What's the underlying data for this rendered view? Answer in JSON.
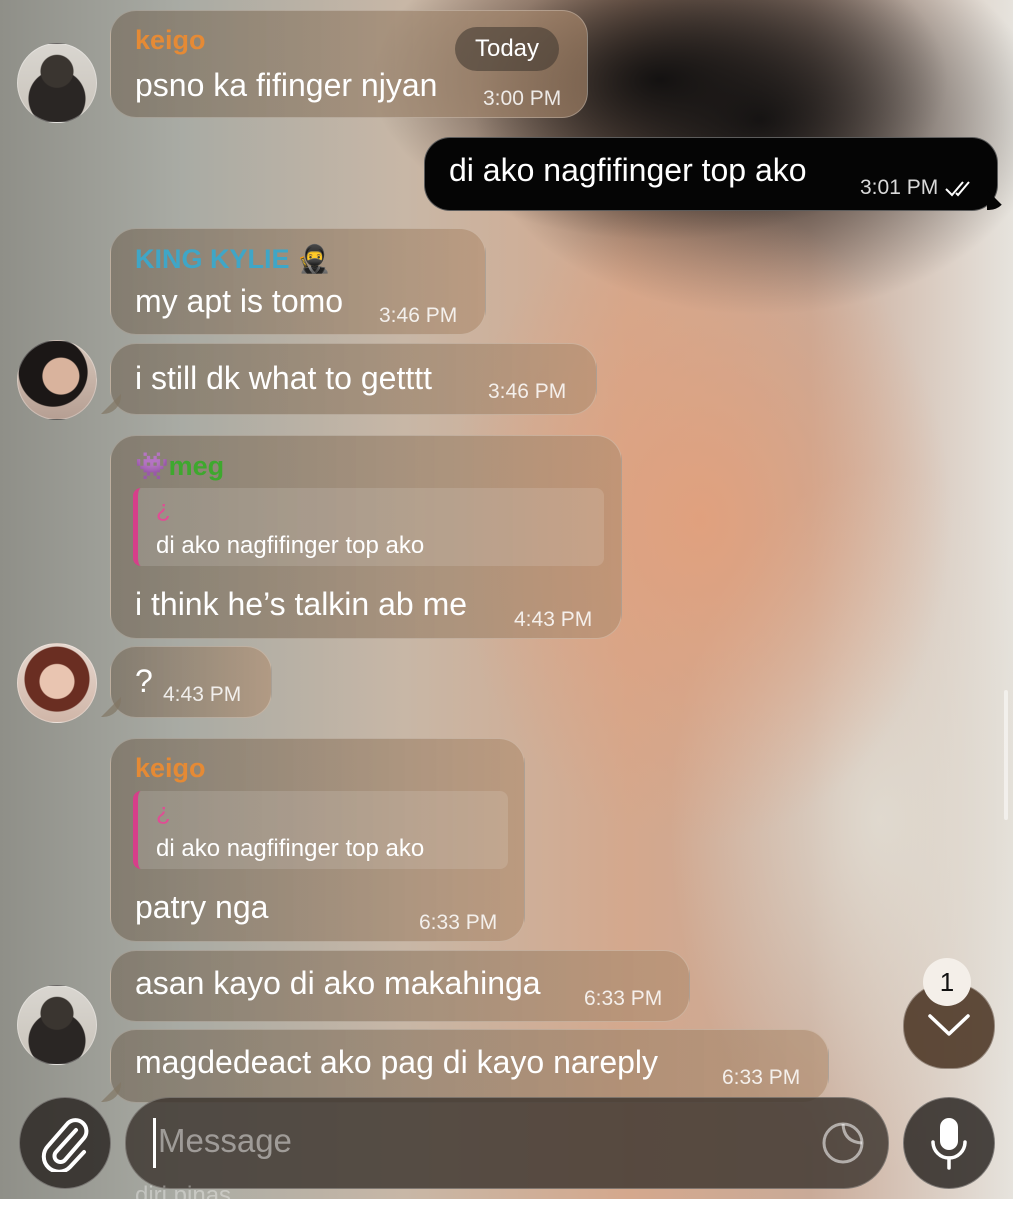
{
  "date_chip": "Today",
  "messages": [
    {
      "id": "m1",
      "sender": "keigo",
      "sender_color": "#e58a35",
      "text": "psno ka fifinger njyan",
      "time": "3:00 PM"
    },
    {
      "id": "m2",
      "outgoing": true,
      "text": "di ako nagfifinger top ako",
      "time": "3:01 PM",
      "status": "read"
    },
    {
      "id": "m3",
      "sender": "KING KYLIE 🥷",
      "sender_color": "#3fa6c7",
      "text": "my apt is tomo",
      "time": "3:46 PM"
    },
    {
      "id": "m4",
      "text": "i still dk what to getttt",
      "time": "3:46 PM"
    },
    {
      "id": "m5",
      "sender": "👾meg",
      "sender_color": "#3ea82e",
      "reply": {
        "author": "¿",
        "text": "di ako nagfifinger top ako"
      },
      "text": "i think he’s talkin ab me",
      "time": "4:43 PM"
    },
    {
      "id": "m6",
      "text": "?",
      "time": "4:43 PM"
    },
    {
      "id": "m7",
      "sender": "keigo",
      "sender_color": "#e58a35",
      "reply": {
        "author": "¿",
        "text": "di ako nagfifinger top ako"
      },
      "text": "patry nga",
      "time": "6:33 PM"
    },
    {
      "id": "m8",
      "text": "asan kayo di ako makahinga",
      "time": "6:33 PM"
    },
    {
      "id": "m9",
      "text": "magdedeact ako pag di kayo nareply",
      "time": "6:33 PM"
    }
  ],
  "unread_badge": "1",
  "composer": {
    "placeholder": "Message"
  },
  "ghost_text": "diri pinas",
  "icons": {
    "attach": "paperclip-icon",
    "sticker": "sticker-icon",
    "mic": "microphone-icon",
    "scroll": "chevron-down-icon",
    "read": "double-check-icon"
  }
}
